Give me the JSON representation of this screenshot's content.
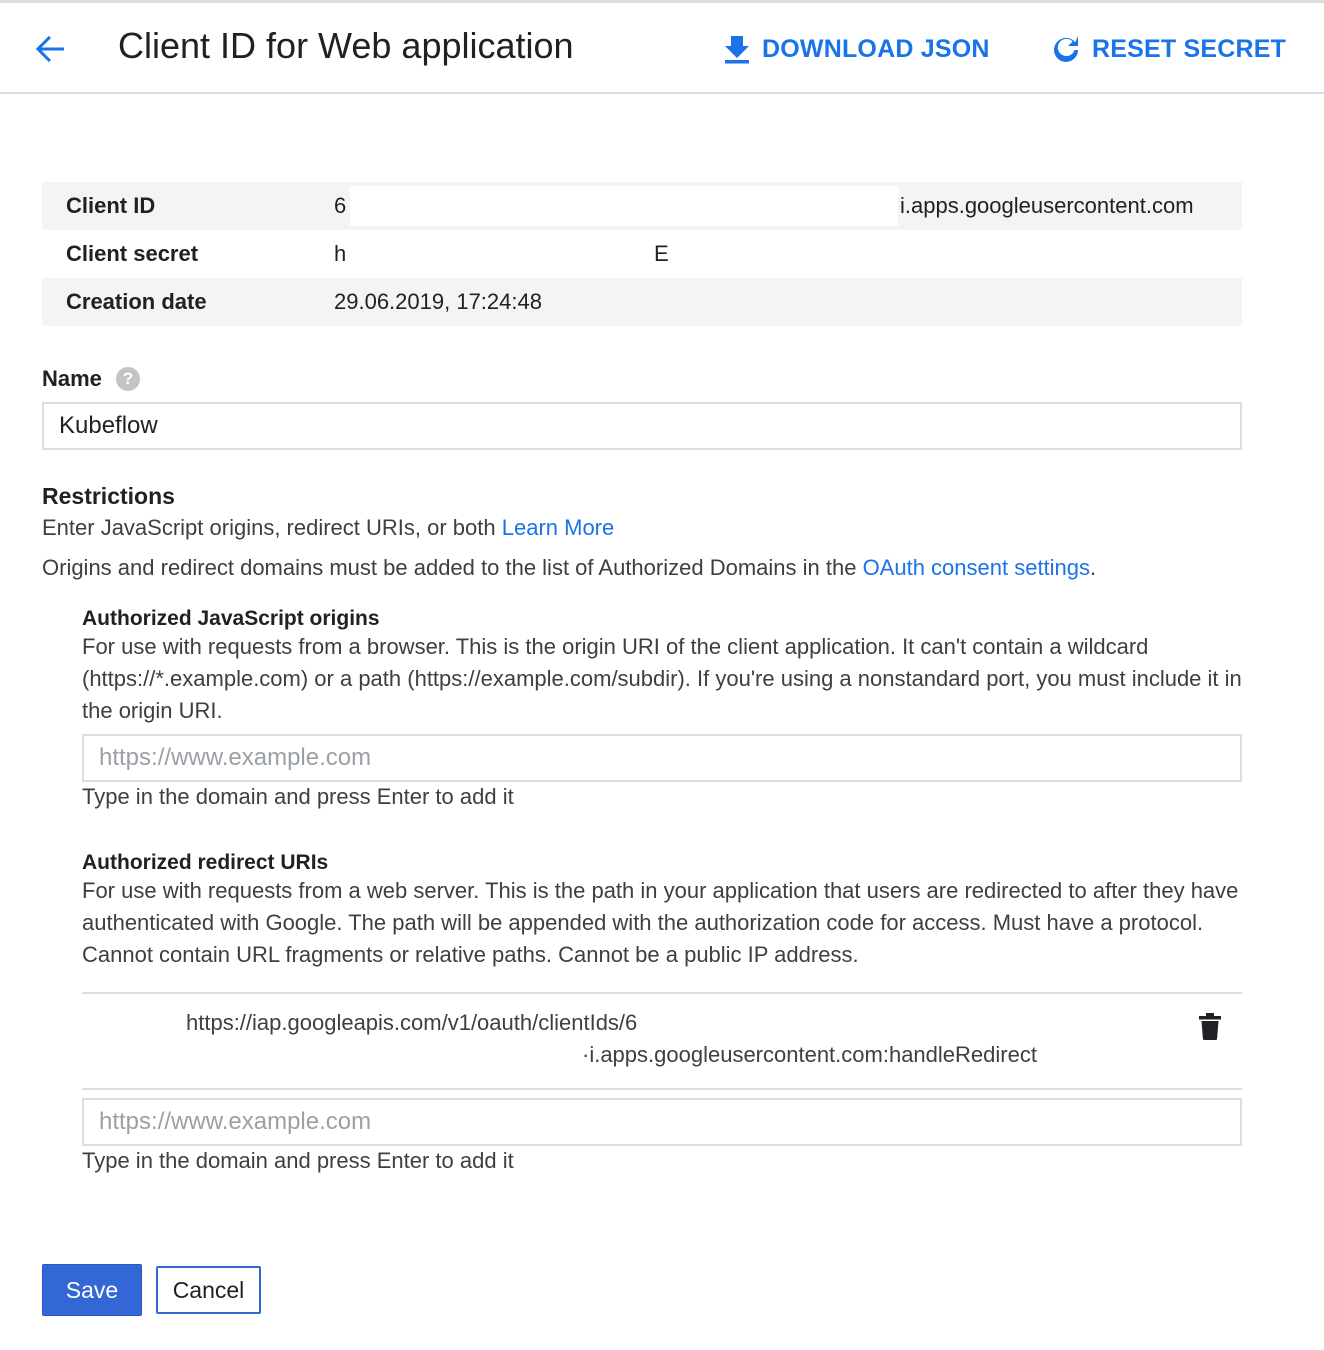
{
  "header": {
    "title": "Client ID for Web application",
    "download_label": "DOWNLOAD JSON",
    "reset_label": "RESET SECRET",
    "accent_color": "#1a73e8"
  },
  "client_info": {
    "client_id_label": "Client ID",
    "client_id_start": "6",
    "client_id_end": "i.apps.googleusercontent.com",
    "client_secret_label": "Client secret",
    "client_secret_start": "h",
    "client_secret_end": "E",
    "creation_date_label": "Creation date",
    "creation_date_value": "29.06.2019, 17:24:48"
  },
  "name_section": {
    "label": "Name",
    "help_icon": "?",
    "value": "Kubeflow"
  },
  "restrictions": {
    "title": "Restrictions",
    "desc1_text": "Enter JavaScript origins, redirect URIs, or both ",
    "desc1_link": "Learn More",
    "desc2_text": "Origins and redirect domains must be added to the list of Authorized Domains in the ",
    "desc2_link": "OAuth consent settings",
    "desc2_end": "."
  },
  "js_origins": {
    "title": "Authorized JavaScript origins",
    "description": "For use with requests from a browser. This is the origin URI of the client application. It can't contain a wildcard (https://*.example.com) or a path (https://example.com/subdir). If you're using a nonstandard port, you must include it in the origin URI.",
    "placeholder": "https://www.example.com",
    "hint": "Type in the domain and press Enter to add it"
  },
  "redirect_uris": {
    "title": "Authorized redirect URIs",
    "description": "For use with requests from a web server. This is the path in your application that users are redirected to after they have authenticated with Google. The path will be appended with the authorization code for access. Must have a protocol. Cannot contain URL fragments or relative paths. Cannot be a public IP address.",
    "uri_line1": "https://iap.googleapis.com/v1/oauth/clientIds/6",
    "uri_line2": "·i.apps.googleusercontent.com:handleRedirect",
    "placeholder": "https://www.example.com",
    "hint": "Type in the domain and press Enter to add it"
  },
  "actions": {
    "save_label": "Save",
    "cancel_label": "Cancel",
    "save_color": "#3367d6"
  }
}
